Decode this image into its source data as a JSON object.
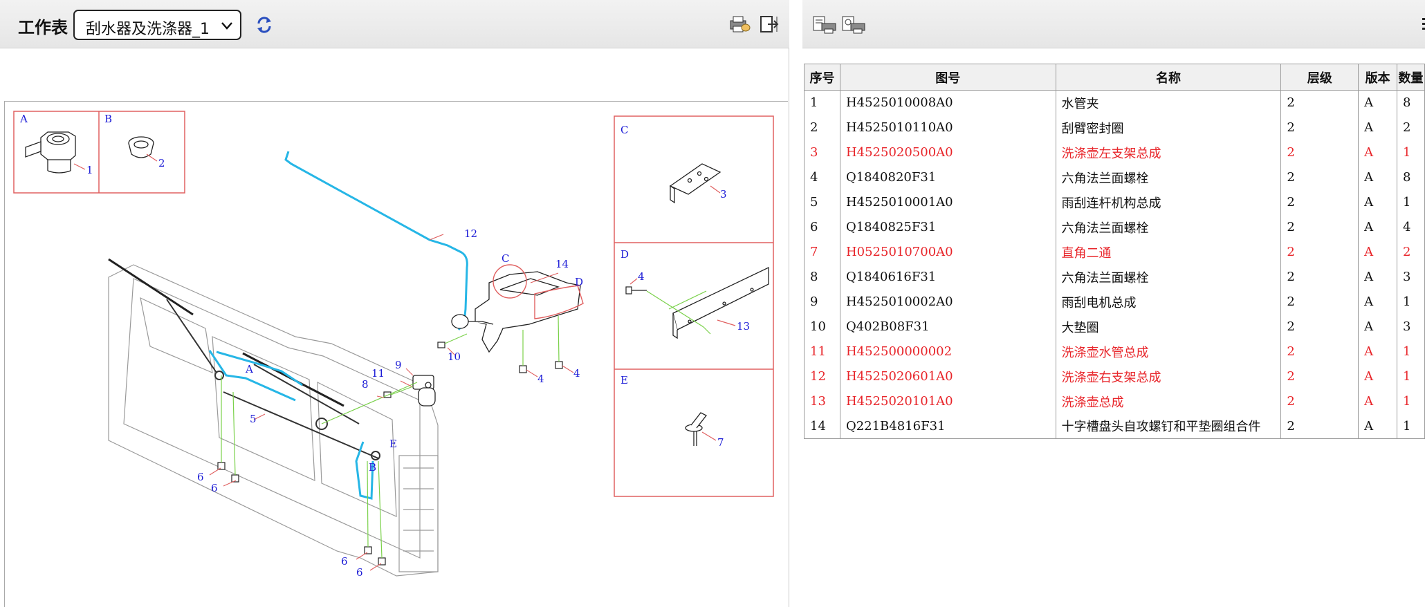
{
  "left_toolbar": {
    "worksheet_label": "工作表",
    "worksheet_selected": "刮水器及洗涤器_1",
    "icons": [
      "refresh-icon",
      "print-icon",
      "export-icon"
    ]
  },
  "drawing": {
    "detail_labels": [
      "A",
      "B",
      "C",
      "D",
      "E"
    ],
    "callouts": [
      "1",
      "2",
      "3",
      "4",
      "4",
      "4",
      "5",
      "6",
      "6",
      "6",
      "6",
      "7",
      "8",
      "9",
      "10",
      "11",
      "12",
      "13",
      "14"
    ],
    "main_labels": [
      "C",
      "D",
      "A",
      "B",
      "E"
    ],
    "colors": {
      "frame": "#e06060",
      "callout": "#1b1bd6",
      "hose": "#26b6e6",
      "leader": "#7ad14a",
      "line": "#222222"
    }
  },
  "right_toolbar": {
    "icons": [
      "print-list-icon",
      "print-preview-icon",
      "more-icon"
    ]
  },
  "bom_table": {
    "headers": [
      "序号",
      "图号",
      "名称",
      "层级",
      "版本",
      "数量"
    ],
    "rows": [
      {
        "no": "1",
        "part": "H4525010008A0",
        "name": "水管夹",
        "level": "2",
        "ver": "A",
        "qty": "8",
        "hl": false
      },
      {
        "no": "2",
        "part": "H4525010110A0",
        "name": "刮臂密封圈",
        "level": "2",
        "ver": "A",
        "qty": "2",
        "hl": false
      },
      {
        "no": "3",
        "part": "H4525020500A0",
        "name": "洗涤壶左支架总成",
        "level": "2",
        "ver": "A",
        "qty": "1",
        "hl": true
      },
      {
        "no": "4",
        "part": "Q1840820F31",
        "name": "六角法兰面螺栓",
        "level": "2",
        "ver": "A",
        "qty": "8",
        "hl": false
      },
      {
        "no": "5",
        "part": "H4525010001A0",
        "name": "雨刮连杆机构总成",
        "level": "2",
        "ver": "A",
        "qty": "1",
        "hl": false
      },
      {
        "no": "6",
        "part": "Q1840825F31",
        "name": "六角法兰面螺栓",
        "level": "2",
        "ver": "A",
        "qty": "4",
        "hl": false
      },
      {
        "no": "7",
        "part": "H0525010700A0",
        "name": "直角二通",
        "level": "2",
        "ver": "A",
        "qty": "2",
        "hl": true
      },
      {
        "no": "8",
        "part": "Q1840616F31",
        "name": "六角法兰面螺栓",
        "level": "2",
        "ver": "A",
        "qty": "3",
        "hl": false
      },
      {
        "no": "9",
        "part": "H4525010002A0",
        "name": "雨刮电机总成",
        "level": "2",
        "ver": "A",
        "qty": "1",
        "hl": false
      },
      {
        "no": "10",
        "part": "Q402B08F31",
        "name": "大垫圈",
        "level": "2",
        "ver": "A",
        "qty": "3",
        "hl": false
      },
      {
        "no": "11",
        "part": "H452500000002",
        "name": "洗涤壶水管总成",
        "level": "2",
        "ver": "A",
        "qty": "1",
        "hl": true
      },
      {
        "no": "12",
        "part": "H4525020601A0",
        "name": "洗涤壶右支架总成",
        "level": "2",
        "ver": "A",
        "qty": "1",
        "hl": true
      },
      {
        "no": "13",
        "part": "H4525020101A0",
        "name": "洗涤壶总成",
        "level": "2",
        "ver": "A",
        "qty": "1",
        "hl": true
      },
      {
        "no": "14",
        "part": "Q221B4816F31",
        "name": "十字槽盘头自攻螺钉和平垫圈组合件",
        "level": "2",
        "ver": "A",
        "qty": "1",
        "hl": false
      }
    ]
  }
}
